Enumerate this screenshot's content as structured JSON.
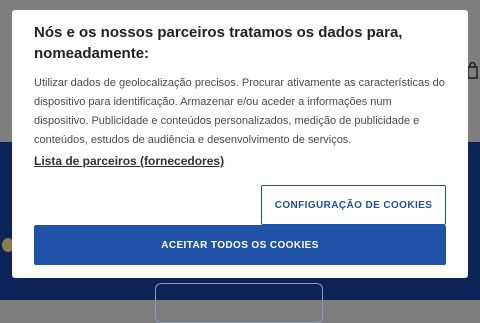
{
  "consent": {
    "title": "Nós e os nossos parceiros tratamos os dados para, nomeadamente:",
    "body": "Utilizar dados de geolocalização precisos. Procurar ativamente as características do dispositivo para identificação. Armazenar e/ou aceder a informações num dispositivo. Publicidade e conteúdos personalizados, medição de publicidade e conteúdos, estudos de audiência e desenvolvimento de serviços.",
    "partners_link": "Lista de parceiros (fornecedores)",
    "config_button": "CONFIGURAÇÃO DE COOKIES",
    "accept_button": "ACEITAR TODOS OS COOKIES"
  },
  "colors": {
    "accent": "#2052a8",
    "background_header": "#7f7f7f",
    "background_body": "#0c2457"
  },
  "icons": {
    "cart": "cart-icon"
  }
}
